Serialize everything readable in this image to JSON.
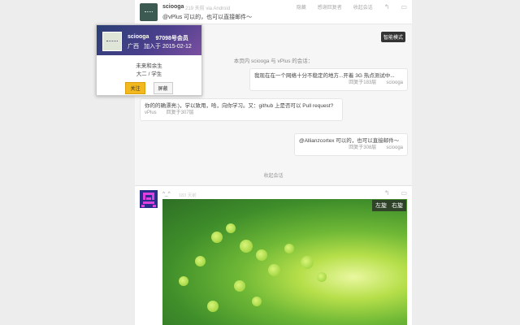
{
  "top_reply": {
    "author": "sciooga",
    "meta": "219 天前 via Android",
    "body": "@vPlus 可以的，也可以直接邮件～",
    "actions": [
      "隐藏",
      "感谢回复者",
      "收起会话"
    ]
  },
  "smart_mode_label": "智能模式",
  "conversation": {
    "title": "本页内 sciooga 与 vPlus 的会话：",
    "messages": [
      {
        "text": "我现在在一个网络十分不稳定的地方...开着 3G 热点测试中...",
        "floor": "回复于183层",
        "author": "sciooga"
      },
      {
        "text": "你的的确漂亮:)，学以致用，哈，向你学习。又：github 上是否可以 Pull request?",
        "author": "vPlus",
        "floor": "回复于307层"
      },
      {
        "text": "@Allianzcortex 可以的，也可以直接邮件～",
        "floor": "回复于308层",
        "author": "sciooga"
      }
    ],
    "collapse_label": "收起会话"
  },
  "bottom_post": {
    "author": "^_^",
    "meta": "183 天前",
    "rotate_left": "左旋",
    "rotate_right": "右旋"
  },
  "profile_card": {
    "username": "sciooga",
    "member_no": "97098号会员",
    "location": "广西",
    "joined": "加入于 2015-02-12",
    "bio_line1": "未来和余生",
    "bio_line2": "大二 / 学生",
    "follow_label": "关注",
    "block_label": "屏蔽",
    "accent_color": "#f3b81d"
  }
}
